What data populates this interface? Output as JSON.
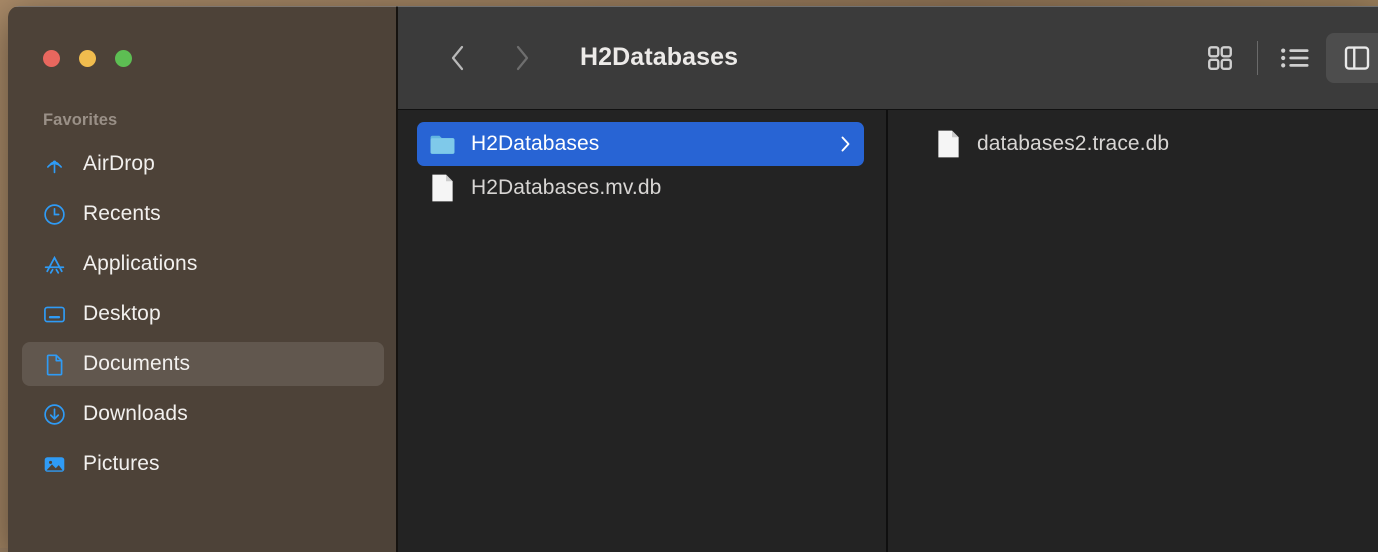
{
  "window": {
    "title": "H2Databases",
    "traffic_lights": [
      {
        "name": "close",
        "color": "#e8675e"
      },
      {
        "name": "minimize",
        "color": "#f0bc4e"
      },
      {
        "name": "zoom",
        "color": "#5dbe53"
      }
    ]
  },
  "sidebar": {
    "section_header": "Favorites",
    "items": [
      {
        "label": "AirDrop",
        "icon": "airdrop-icon",
        "selected": false
      },
      {
        "label": "Recents",
        "icon": "clock-icon",
        "selected": false
      },
      {
        "label": "Applications",
        "icon": "applications-icon",
        "selected": false
      },
      {
        "label": "Desktop",
        "icon": "desktop-icon",
        "selected": false
      },
      {
        "label": "Documents",
        "icon": "document-icon",
        "selected": true
      },
      {
        "label": "Downloads",
        "icon": "download-icon",
        "selected": false
      },
      {
        "label": "Pictures",
        "icon": "pictures-icon",
        "selected": false
      }
    ]
  },
  "toolbar": {
    "back_label": "Back",
    "forward_label": "Forward",
    "view_buttons": [
      {
        "name": "icon-view-button",
        "icon": "grid-icon",
        "active": false
      },
      {
        "name": "list-view-button",
        "icon": "list-icon",
        "active": false
      },
      {
        "name": "column-view-button",
        "icon": "column-icon",
        "active": true
      }
    ]
  },
  "columns": [
    {
      "name": "column-1",
      "entries": [
        {
          "name": "H2Databases",
          "type": "folder",
          "selected": true,
          "has_chevron": true
        },
        {
          "name": "H2Databases.mv.db",
          "type": "file",
          "selected": false,
          "has_chevron": false
        }
      ]
    },
    {
      "name": "column-2",
      "entries": [
        {
          "name": "databases2.trace.db",
          "type": "file",
          "selected": false,
          "has_chevron": false
        }
      ]
    }
  ],
  "colors": {
    "sidebar_bg": "#4d4238",
    "toolbar_bg": "#3b3b3b",
    "content_bg": "#232323",
    "selection_blue": "#2864d4",
    "accent_blue": "#2f9bf5"
  }
}
